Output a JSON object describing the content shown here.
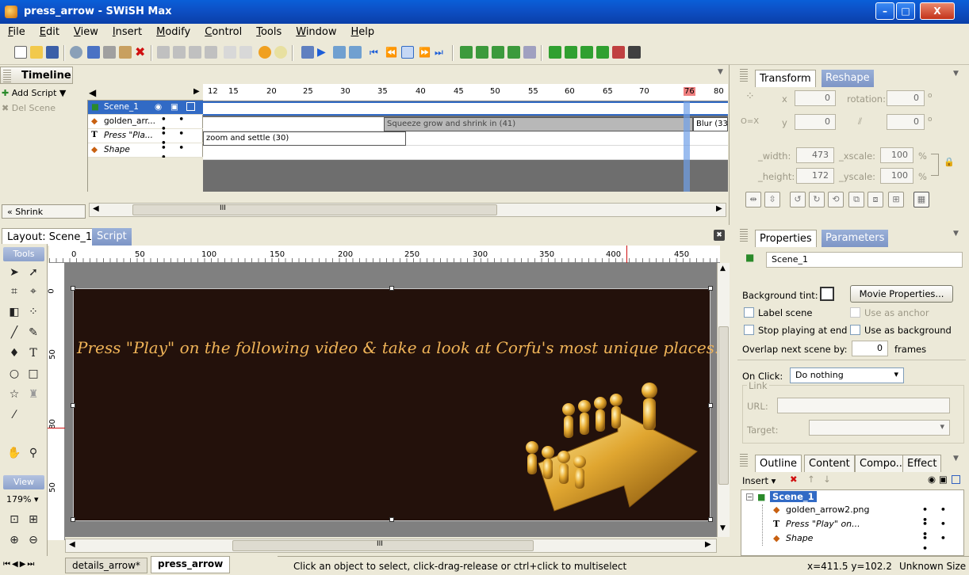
{
  "window": {
    "title": "press_arrow - SWiSH Max",
    "controls": [
      "–",
      "□",
      "X"
    ]
  },
  "menu": [
    "File",
    "Edit",
    "View",
    "Insert",
    "Modify",
    "Control",
    "Tools",
    "Window",
    "Help"
  ],
  "timeline": {
    "title": "Timeline",
    "add_script": "Add Script ▼",
    "del_scene": "Del Scene",
    "shrink": "« Shrink",
    "frame_labels": [
      "12",
      "15",
      "20",
      "25",
      "30",
      "35",
      "40",
      "45",
      "50",
      "55",
      "60",
      "65",
      "70",
      "76",
      "80"
    ],
    "current_frame": "76",
    "layers": [
      {
        "name": "Scene_1",
        "dots": ""
      },
      {
        "name": "golden_arr...",
        "dots": "• • •"
      },
      {
        "name": "Press \"Pla...",
        "dots": "• • •"
      },
      {
        "name": "Shape",
        "dots": "• • •"
      }
    ],
    "tweens": {
      "squeeze": "Squeeze grow and shrink in (41)",
      "blur": "Blur (33)",
      "zoom": "zoom and settle (30)"
    },
    "scroll_mark": "III"
  },
  "layout": {
    "tabs": {
      "layout": "Layout: Scene_1",
      "script": "Script"
    },
    "tools_header": "Tools",
    "view_header": "View",
    "zoom": "179%",
    "hruler_labels": [
      "0",
      "50",
      "100",
      "150",
      "200",
      "250",
      "300",
      "350",
      "400",
      "450"
    ],
    "vruler_labels": [
      "0",
      "50",
      "80",
      "50"
    ],
    "stage_text": "Press \"Play\" on the following video & take a look at Corfu's most unique places!",
    "scroll_mark": "III"
  },
  "doc_tabs": [
    "details_arrow*",
    "press_arrow"
  ],
  "status": {
    "hint": "Click an object to select, click-drag-release or ctrl+click to multiselect",
    "coords": "x=411.5 y=102.2",
    "size": "Unknown Size"
  },
  "transform": {
    "tabs": {
      "active": "Transform",
      "other": "Reshape"
    },
    "x_label": "x",
    "x": "0",
    "rotation_label": "rotation:",
    "rotation": "0",
    "y_label": "y",
    "y": "0",
    "skew": "0",
    "width_label": "_width:",
    "width": "473",
    "xscale_label": "_xscale:",
    "xscale": "100",
    "height_label": "_height:",
    "height": "172",
    "yscale_label": "_yscale:",
    "yscale": "100",
    "percent": "%",
    "degree": "o"
  },
  "properties": {
    "tabs": {
      "active": "Properties",
      "other": "Parameters"
    },
    "scene_name": "Scene_1",
    "bg_tint_label": "Background tint:",
    "movie_props": "Movie Properties...",
    "label_scene": "Label scene",
    "use_as_anchor": "Use as anchor",
    "stop_playing": "Stop playing at end",
    "use_as_bg": "Use as background",
    "overlap_label": "Overlap next scene by:",
    "overlap_value": "0",
    "frames": "frames",
    "onclick_label": "On Click:",
    "onclick_value": "Do nothing",
    "link_label": "Link",
    "url_label": "URL:",
    "target_label": "Target:"
  },
  "outline": {
    "tabs": [
      "Outline",
      "Content",
      "Compo...",
      "Effect"
    ],
    "insert": "Insert",
    "tree": [
      {
        "name": "Scene_1",
        "dots": ""
      },
      {
        "name": "golden_arrow2.png",
        "dots": "• • •"
      },
      {
        "name": "Press \"Play\" on...",
        "dots": "• • •"
      },
      {
        "name": "Shape",
        "dots": "• • •"
      }
    ]
  },
  "colors": {
    "stage_bg": "#23110b",
    "stage_text": "#f0b458",
    "accent": "#0a5fd8",
    "selection": "#316ac5"
  }
}
